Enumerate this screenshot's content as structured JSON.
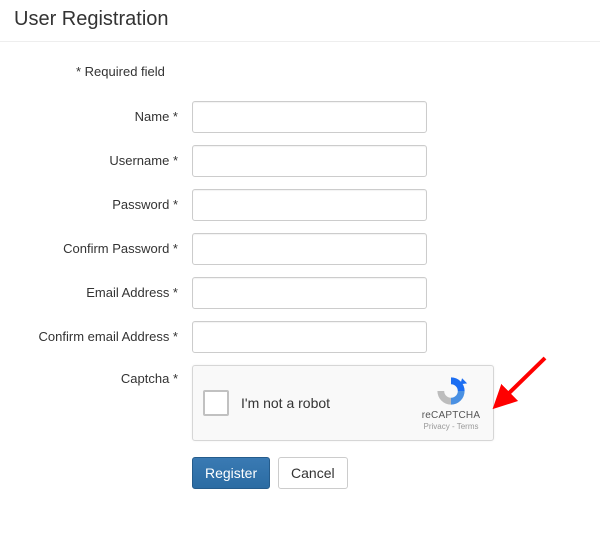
{
  "title": "User Registration",
  "required_note": "* Required field",
  "fields": {
    "name": {
      "label": "Name *",
      "value": ""
    },
    "username": {
      "label": "Username *",
      "value": ""
    },
    "password": {
      "label": "Password *",
      "value": ""
    },
    "confirm_password": {
      "label": "Confirm Password *",
      "value": ""
    },
    "email": {
      "label": "Email Address *",
      "value": ""
    },
    "confirm_email": {
      "label": "Confirm email Address *",
      "value": ""
    },
    "captcha": {
      "label": "Captcha *"
    }
  },
  "recaptcha": {
    "checkbox_label": "I'm not a robot",
    "brand": "reCAPTCHA",
    "privacy": "Privacy",
    "terms": "Terms",
    "sep": " - "
  },
  "buttons": {
    "register": "Register",
    "cancel": "Cancel"
  },
  "annotation": {
    "arrow_color": "#ff0000"
  }
}
